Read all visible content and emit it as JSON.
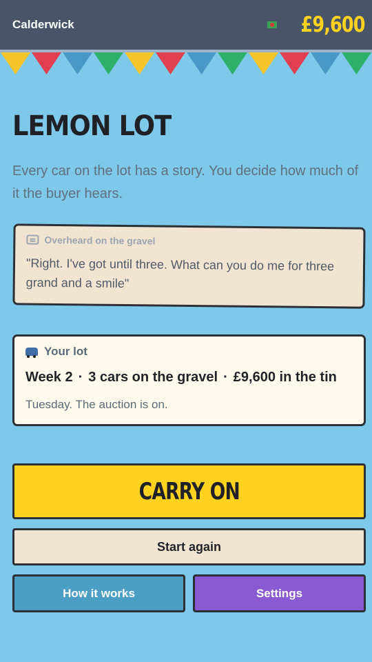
{
  "header": {
    "town": "Calderwick",
    "money": "£9,600",
    "money_icon": "cash-note-icon"
  },
  "bunting_colors": [
    "#f5c52a",
    "#e0404f",
    "#4a98c7",
    "#2fb06a"
  ],
  "title": "LEMON LOT",
  "tagline": "Every car on the lot has a story. You decide how much of it the buyer hears.",
  "overheard": {
    "icon": "speech-bubble-icon",
    "heading": "Overheard on the gravel",
    "quote": "\"Right. I've got until three. What can you do me for three grand and a smile\""
  },
  "lot": {
    "icon": "car-icon",
    "heading": "Your lot",
    "week": "Week 2",
    "separator": "·",
    "cars": "3 cars on the gravel",
    "tin": "£9,600 in the tin",
    "note": "Tuesday. The auction is on."
  },
  "buttons": {
    "carry_on": "CARRY ON",
    "start_again": "Start again",
    "how_it_works": "How it works",
    "settings": "Settings"
  }
}
